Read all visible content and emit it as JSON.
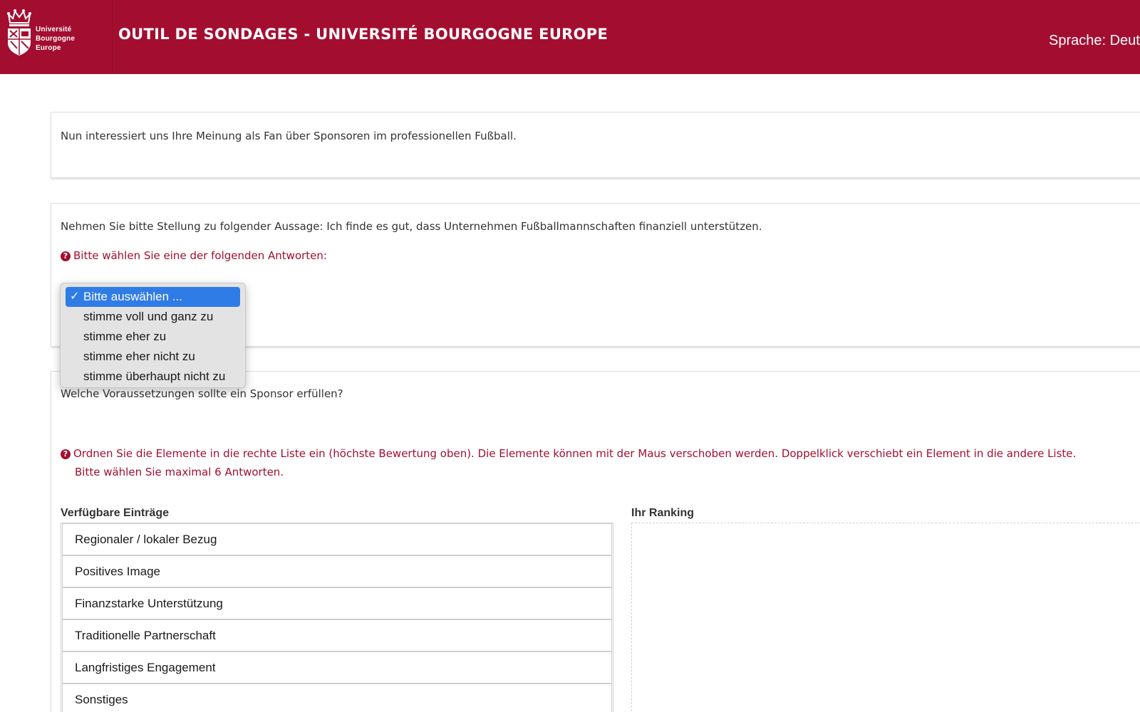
{
  "header": {
    "logo_lines": [
      "Université",
      "Bourgogne",
      "Europe"
    ],
    "title": "OUTIL DE SONDAGES - UNIVERSITÉ BOURGOGNE EUROPE",
    "language_label": "Sprache: Deuts",
    "background_color": "#a30e30"
  },
  "intro": {
    "text": "Nun interessiert uns Ihre Meinung als Fan über Sponsoren im professionellen Fußball."
  },
  "question1": {
    "text": "Nehmen Sie bitte Stellung zu folgender Aussage: Ich finde es gut, dass Unternehmen Fußballmannschaften finanziell unterstützen.",
    "help_icon": "question-circle-icon",
    "help": "Bitte wählen Sie eine der folgenden Antworten:",
    "dropdown": {
      "selected_marker": "✓",
      "options": [
        "Bitte auswählen ...",
        "stimme voll und ganz zu",
        "stimme eher zu",
        "stimme eher nicht zu",
        "stimme überhaupt nicht zu"
      ]
    }
  },
  "question2": {
    "text": "Welche Voraussetzungen sollte ein Sponsor erfüllen?",
    "help_line1": "Ordnen Sie die Elemente in die rechte Liste ein (höchste Bewertung oben). Die Elemente können mit der Maus verschoben werden. Doppelklick verschiebt ein Element in die andere Liste.",
    "help_line2": "Bitte wählen Sie maximal 6 Antworten.",
    "available_heading": "Verfügbare Einträge",
    "ranking_heading": "Ihr Ranking",
    "available_items": [
      "Regionaler / lokaler Bezug",
      "Positives Image",
      "Finanzstarke Unterstützung",
      "Traditionelle Partnerschaft",
      "Langfristiges Engagement",
      "Sonstiges"
    ]
  }
}
